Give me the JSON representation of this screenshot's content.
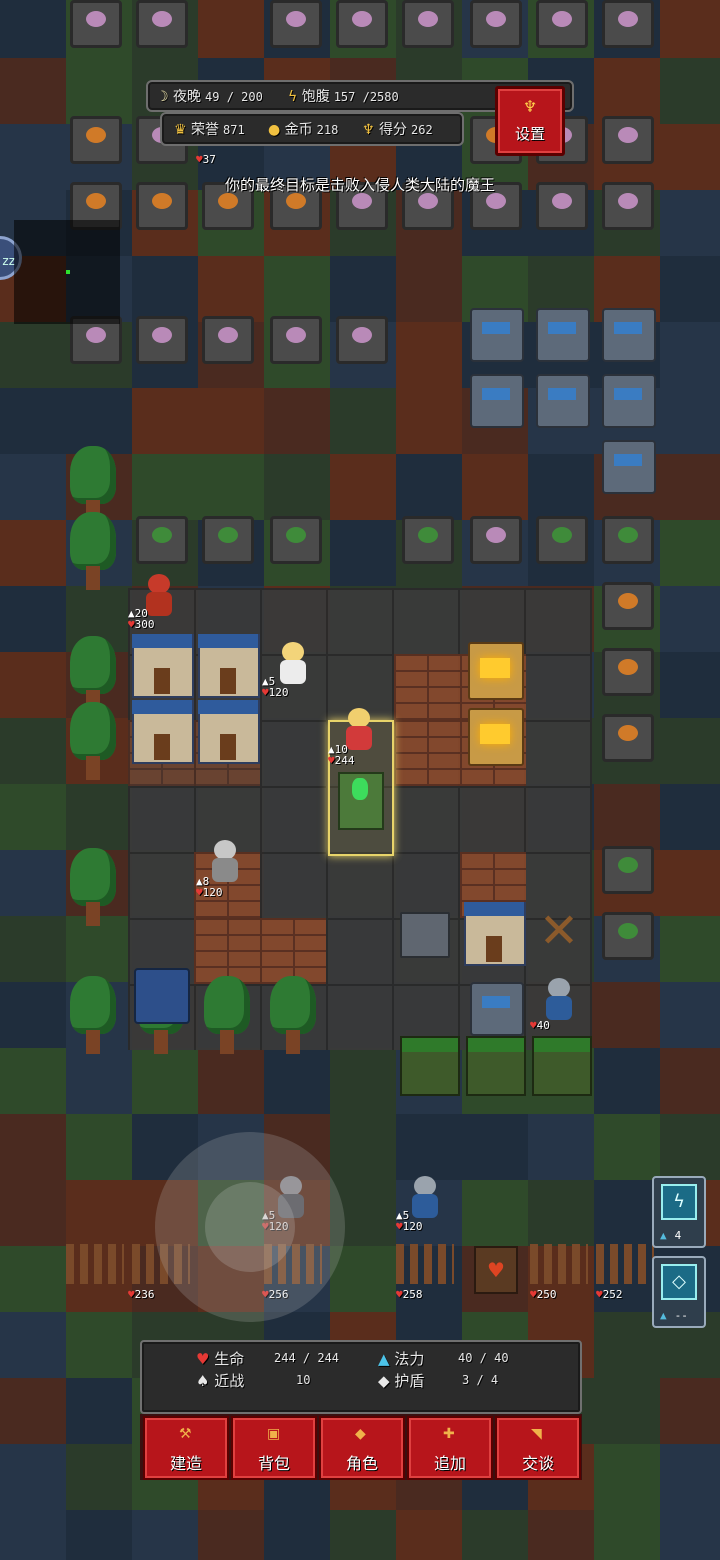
{
  "hud": {
    "night_label": "夜晚",
    "night_value": "49 / 200",
    "food_label": "饱腹",
    "food_value": "157 /2580",
    "honor_label": "荣誉",
    "honor_value": "871",
    "gold_label": "金币",
    "gold_value": "218",
    "score_label": "得分",
    "score_value": "262",
    "settings_label": "设置"
  },
  "objective": "你的最终目标是击败入侵人类大陆的魔王",
  "sleep_label": "zz",
  "map_labels": {
    "top_hp": "37",
    "hero_atk": "10",
    "hero_hp": "244",
    "redhood_atk": "20",
    "redhood_hp": "300",
    "angel_atk": "5",
    "angel_hp": "120",
    "elder_atk": "8",
    "elder_hp": "120",
    "knight_hp": "40",
    "guard1_atk": "5",
    "guard1_hp": "120",
    "guard2_atk": "5",
    "guard2_hp": "120",
    "wall1": "236",
    "wall2": "256",
    "wall3": "258",
    "wall4": "250",
    "wall5": "252"
  },
  "skills": [
    {
      "icon": "lightning-icon",
      "count": "4"
    },
    {
      "icon": "shield-icon",
      "count": "--"
    }
  ],
  "stats": {
    "hp_label": "生命",
    "hp_value": "244 / 244",
    "mp_label": "法力",
    "mp_value": "40 / 40",
    "melee_label": "近战",
    "melee_value": "10",
    "shield_label": "护盾",
    "shield_value": "3 / 4"
  },
  "actions": [
    {
      "label": "建造"
    },
    {
      "label": "背包"
    },
    {
      "label": "角色"
    },
    {
      "label": "追加"
    },
    {
      "label": "交谈"
    }
  ]
}
